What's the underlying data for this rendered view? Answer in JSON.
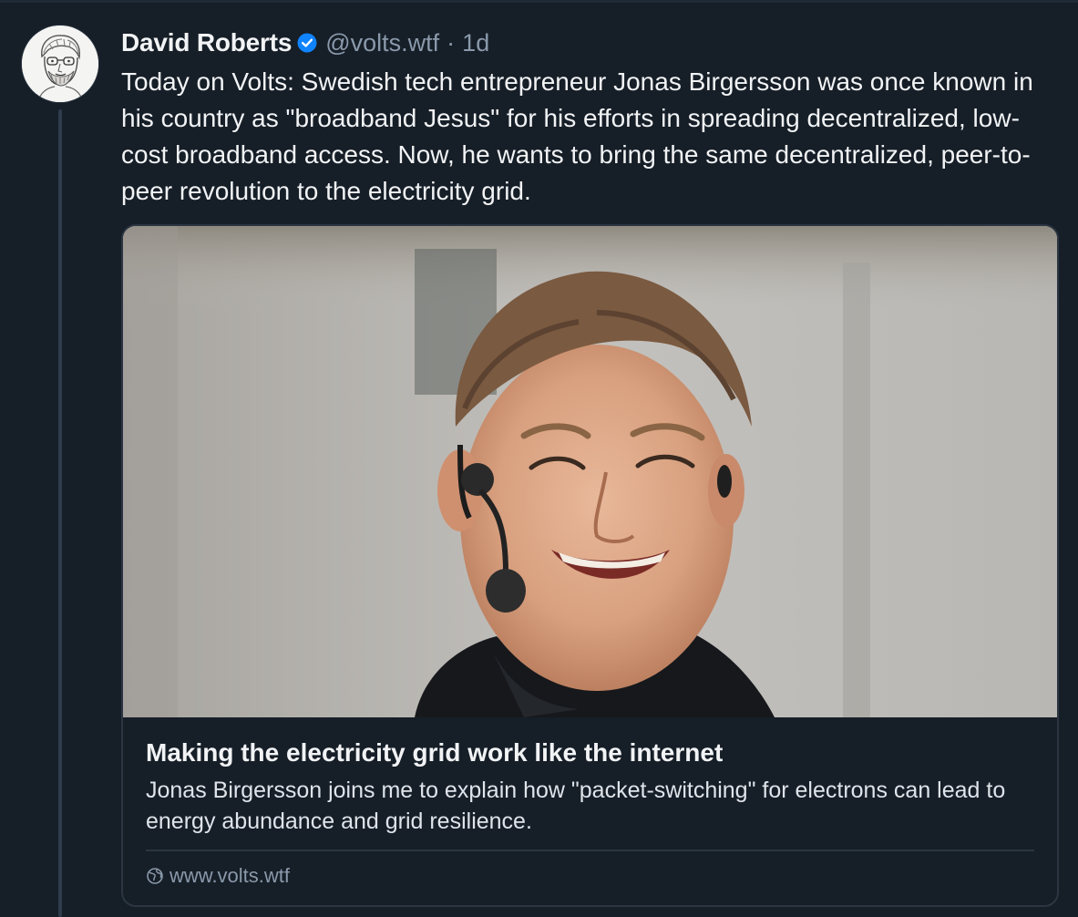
{
  "post": {
    "author": {
      "display_name": "David Roberts",
      "handle": "@volts.wtf",
      "verified_icon": "verified-badge-icon",
      "avatar": "sketch-portrait-avatar"
    },
    "separator": "·",
    "time": "1d",
    "text": "Today on Volts: Swedish tech entrepreneur Jonas Birgersson was once known in his country as \"broadband Jesus\" for his efforts in spreading decentralized, low-cost broadband access. Now, he wants to bring the same decentralized, peer-to-peer revolution to the electricity grid."
  },
  "link_card": {
    "image": "photo-smiling-man-with-headset-microphone",
    "title": "Making the electricity grid work like the internet",
    "description": "Jonas Birgersson joins me to explain how \"packet-switching\" for electrons can lead to energy abundance and grid resilience.",
    "domain": "www.volts.wtf",
    "domain_icon": "globe-icon"
  },
  "colors": {
    "background": "#161e27",
    "text": "#f1f3f5",
    "muted": "#8a99ab",
    "accent": "#1083fe",
    "border": "#2b3642"
  }
}
